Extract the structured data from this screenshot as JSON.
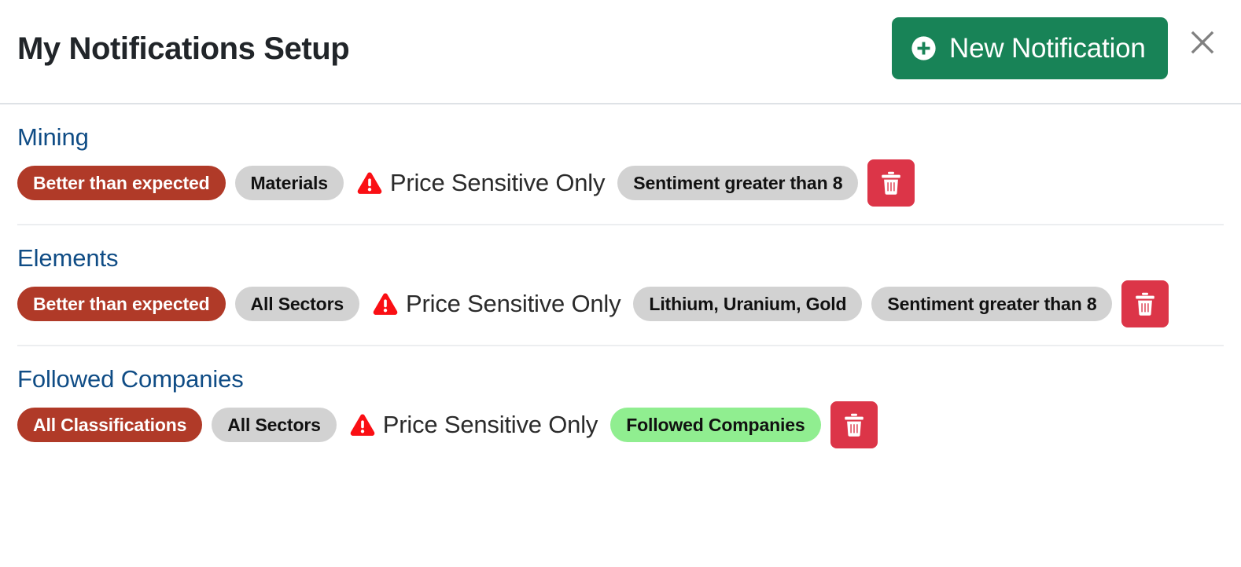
{
  "header": {
    "title": "My Notifications Setup",
    "new_notification_label": "New Notification",
    "plus_icon": "plus-circle-icon",
    "close_icon": "close-icon",
    "button_color": "#188357",
    "close_color": "#808080"
  },
  "colors": {
    "heading_blue": "#0f4c85",
    "pill_red": "#b03a28",
    "pill_gray": "#d2d2d2",
    "pill_green": "#90ee90",
    "delete_red": "#dc3548",
    "warning_red": "#fa0f14"
  },
  "groups": [
    {
      "title": "Mining",
      "pills": [
        {
          "label": "Better than expected",
          "style": "red"
        },
        {
          "label": "Materials",
          "style": "gray"
        }
      ],
      "price_sensitive": {
        "label": "Price Sensitive Only",
        "icon": "warning-triangle-icon"
      },
      "pills_after": [
        {
          "label": "Sentiment greater than 8",
          "style": "gray"
        }
      ],
      "delete": {
        "icon": "trash-icon",
        "label": "Delete notification"
      }
    },
    {
      "title": "Elements",
      "pills": [
        {
          "label": "Better than expected",
          "style": "red"
        },
        {
          "label": "All Sectors",
          "style": "gray"
        }
      ],
      "price_sensitive": {
        "label": "Price Sensitive Only",
        "icon": "warning-triangle-icon"
      },
      "pills_after": [
        {
          "label": "Lithium, Uranium, Gold",
          "style": "gray"
        },
        {
          "label": "Sentiment greater than 8",
          "style": "gray"
        }
      ],
      "delete": {
        "icon": "trash-icon",
        "label": "Delete notification"
      }
    },
    {
      "title": "Followed Companies",
      "pills": [
        {
          "label": "All Classifications",
          "style": "red"
        },
        {
          "label": "All Sectors",
          "style": "gray"
        }
      ],
      "price_sensitive": {
        "label": "Price Sensitive Only",
        "icon": "warning-triangle-icon"
      },
      "pills_after": [
        {
          "label": "Followed Companies",
          "style": "green"
        }
      ],
      "delete": {
        "icon": "trash-icon",
        "label": "Delete notification"
      }
    }
  ]
}
